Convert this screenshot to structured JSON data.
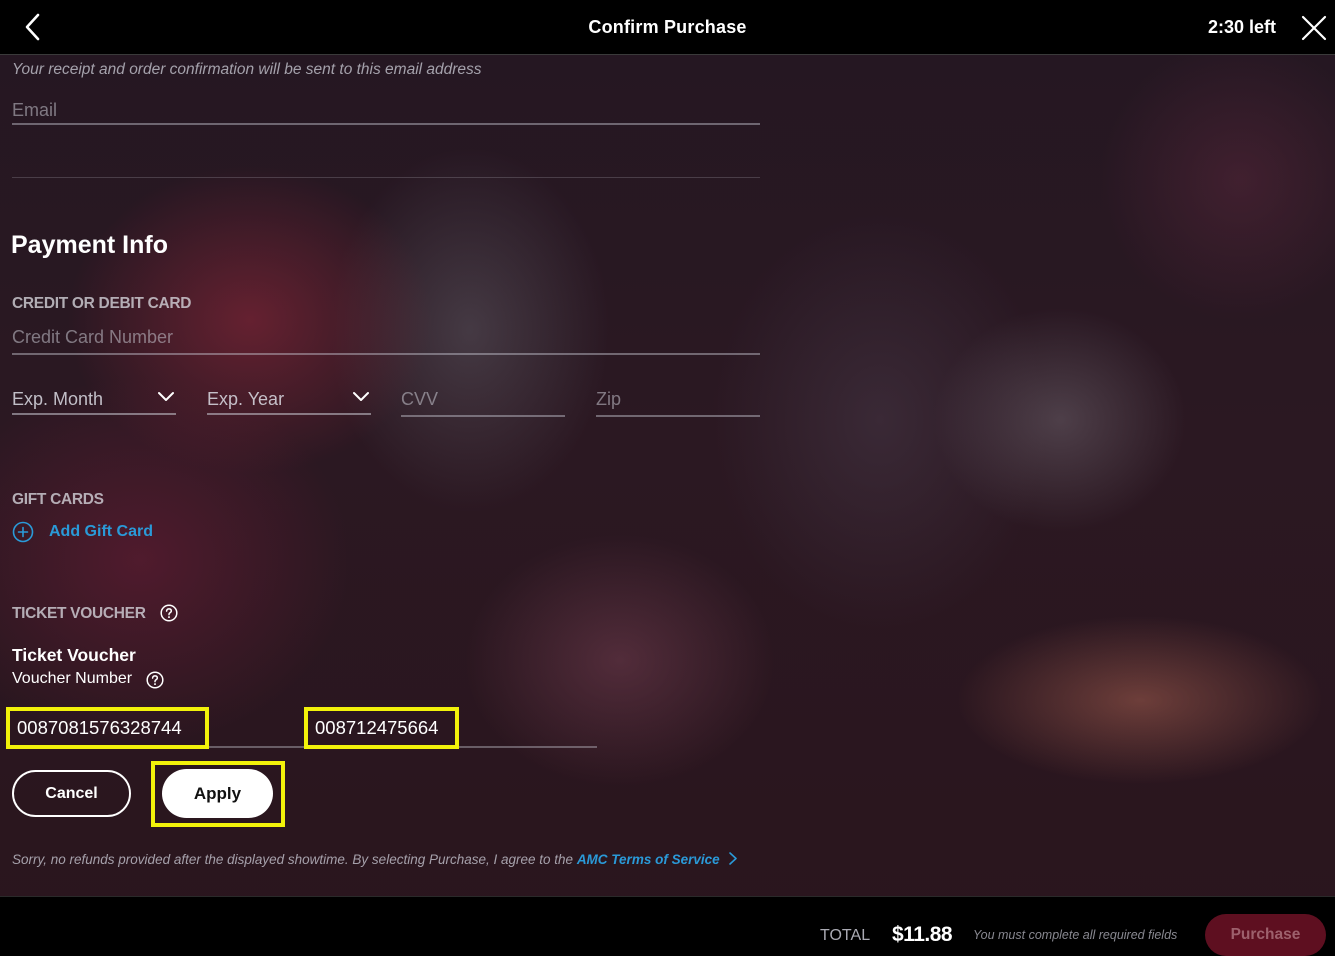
{
  "header": {
    "title": "Confirm Purchase",
    "timer": "2:30 left",
    "back_icon": "chevron-left-icon",
    "close_icon": "close-icon"
  },
  "contact": {
    "receipt_note": "Your receipt and order confirmation will be sent to this email address",
    "email_placeholder": "Email"
  },
  "payment": {
    "title": "Payment Info",
    "card_section_label": "CREDIT OR DEBIT CARD",
    "card_number_placeholder": "Credit Card Number",
    "exp_month_label": "Exp. Month",
    "exp_year_label": "Exp. Year",
    "cvv_placeholder": "CVV",
    "zip_placeholder": "Zip"
  },
  "gift_cards": {
    "section_label": "GIFT CARDS",
    "add_label": "Add Gift Card"
  },
  "voucher": {
    "section_label": "TICKET VOUCHER",
    "title": "Ticket Voucher",
    "subtitle": "Voucher Number",
    "voucher_number_1": "0087081576328744",
    "voucher_number_2": "008712475664",
    "cancel_label": "Cancel",
    "apply_label": "Apply"
  },
  "legal": {
    "refund_note": "Sorry, no refunds provided after the displayed showtime. By selecting Purchase, I agree to the ",
    "terms_link": "AMC Terms of Service"
  },
  "footer": {
    "total_label": "TOTAL",
    "total_amount": "$11.88",
    "required_note": "You must complete all required fields",
    "purchase_label": "Purchase"
  },
  "colors": {
    "accent_link": "#2a9ad8",
    "highlight": "#f2f20a",
    "purchase_disabled": "#5e0f20"
  }
}
